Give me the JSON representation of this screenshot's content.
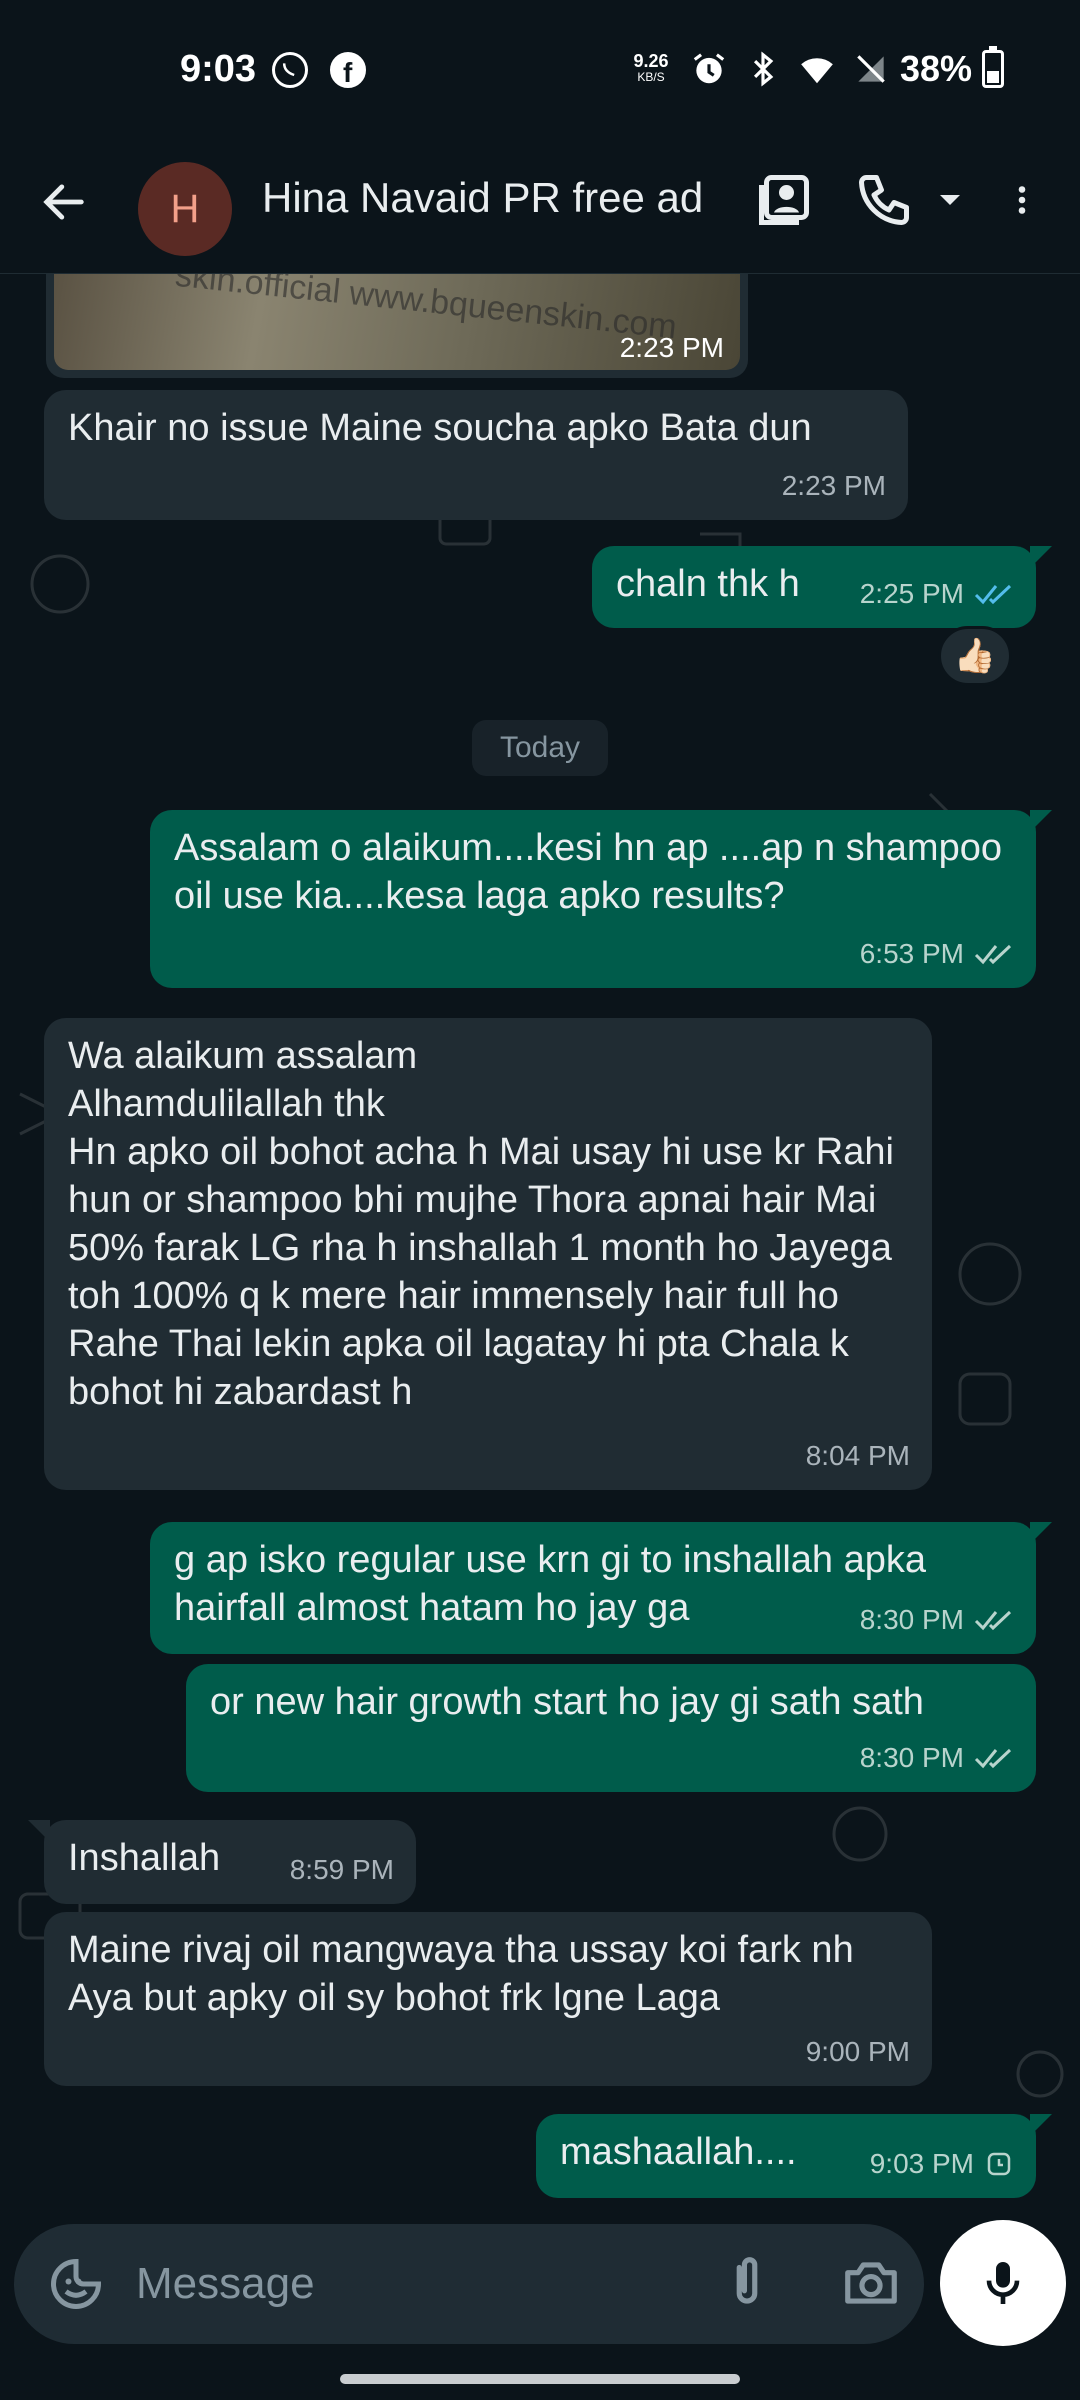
{
  "status_bar": {
    "time": "9:03",
    "net_speed_value": "9.26",
    "net_speed_unit": "KB/S",
    "battery": "38%",
    "icons": [
      "whatsapp-icon",
      "facebook-icon",
      "alarm-icon",
      "bluetooth-icon",
      "wifi-icon",
      "no-sim-icon",
      "battery-icon"
    ]
  },
  "header": {
    "avatar_initial": "H",
    "contact_name": "Hina Navaid PR free ad",
    "icons": [
      "back-arrow-icon",
      "contact-card-icon",
      "phone-icon",
      "dropdown-icon",
      "more-vert-icon"
    ]
  },
  "messages": [
    {
      "id": "m0",
      "dir": "in",
      "type": "image",
      "time": "2:23 PM",
      "watermark": "skin.official  www.bqueenskin.com"
    },
    {
      "id": "m1",
      "dir": "in",
      "text": "Khair no issue Maine soucha apko Bata dun",
      "time": "2:23 PM"
    },
    {
      "id": "m2",
      "dir": "out",
      "text": "chaln thk h",
      "time": "2:25 PM",
      "status": "read",
      "reaction": "👍🏻"
    },
    {
      "id": "m3",
      "dir": "out",
      "text": "Assalam o alaikum....kesi hn ap ....ap n shampoo oil use kia....kesa laga apko results?",
      "time": "6:53 PM",
      "status": "delivered"
    },
    {
      "id": "m4",
      "dir": "in",
      "text": "Wa alaikum assalam\nAlhamdulilallah thk\nHn apko oil bohot acha h Mai usay hi use kr Rahi hun or shampoo bhi mujhe Thora apnai hair Mai 50% farak LG rha h inshallah 1 month ho Jayega toh 100% q k mere hair immensely hair full ho Rahe Thai lekin apka oil lagatay hi pta Chala k bohot hi zabardast h",
      "time": "8:04 PM"
    },
    {
      "id": "m5",
      "dir": "out",
      "text": "g ap isko regular use krn gi to inshallah apka hairfall almost hatam ho jay ga",
      "time": "8:30 PM",
      "status": "delivered"
    },
    {
      "id": "m6",
      "dir": "out",
      "text": "or new hair growth start ho jay gi sath sath",
      "time": "8:30 PM",
      "status": "delivered"
    },
    {
      "id": "m7",
      "dir": "in",
      "text": "Inshallah",
      "time": "8:59 PM"
    },
    {
      "id": "m8",
      "dir": "in",
      "text": "Maine rivaj oil mangwaya tha ussay koi fark nh Aya but apky oil sy bohot frk lgne Laga",
      "time": "9:00 PM"
    },
    {
      "id": "m9",
      "dir": "out",
      "text": "mashaallah....",
      "time": "9:03 PM",
      "status": "pending"
    }
  ],
  "date_divider": "Today",
  "composer": {
    "placeholder": "Message",
    "icons": [
      "sticker-icon",
      "attachment-icon",
      "camera-icon",
      "mic-icon"
    ]
  },
  "colors": {
    "background": "#0b141a",
    "incoming_bubble": "#202c33",
    "outgoing_bubble": "#005c4b",
    "read_ticks": "#53bdeb",
    "avatar_bg": "#5a2a24"
  }
}
